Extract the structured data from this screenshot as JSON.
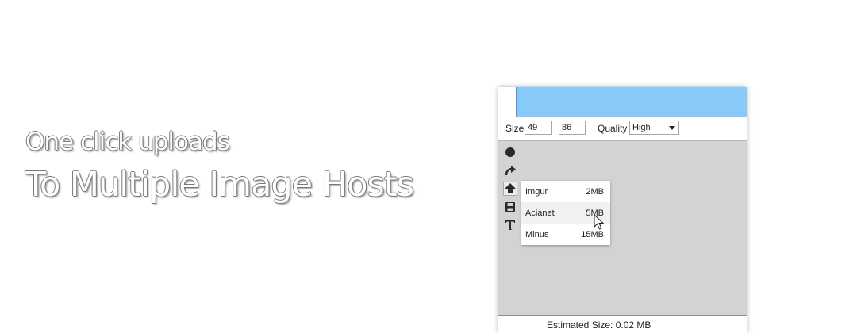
{
  "promo": {
    "line1": "One click uploads",
    "line2": "To Multiple Image Hosts"
  },
  "toolbar": {
    "size_label": "Size",
    "width_value": "49",
    "height_value": "86",
    "quality_label": "Quality",
    "quality_value": "High"
  },
  "tools": [
    "circle-icon",
    "redo-icon",
    "upload-icon",
    "save-icon",
    "text-icon"
  ],
  "upload_menu": [
    {
      "name": "Imgur",
      "size": "2MB"
    },
    {
      "name": "Acianet",
      "size": "5MB"
    },
    {
      "name": "Minus",
      "size": "15MB"
    }
  ],
  "status": {
    "estimated": "Estimated Size: 0.02 MB"
  },
  "colors": {
    "canvas_fill": "#87cafa",
    "workspace": "#d3d3d3"
  }
}
